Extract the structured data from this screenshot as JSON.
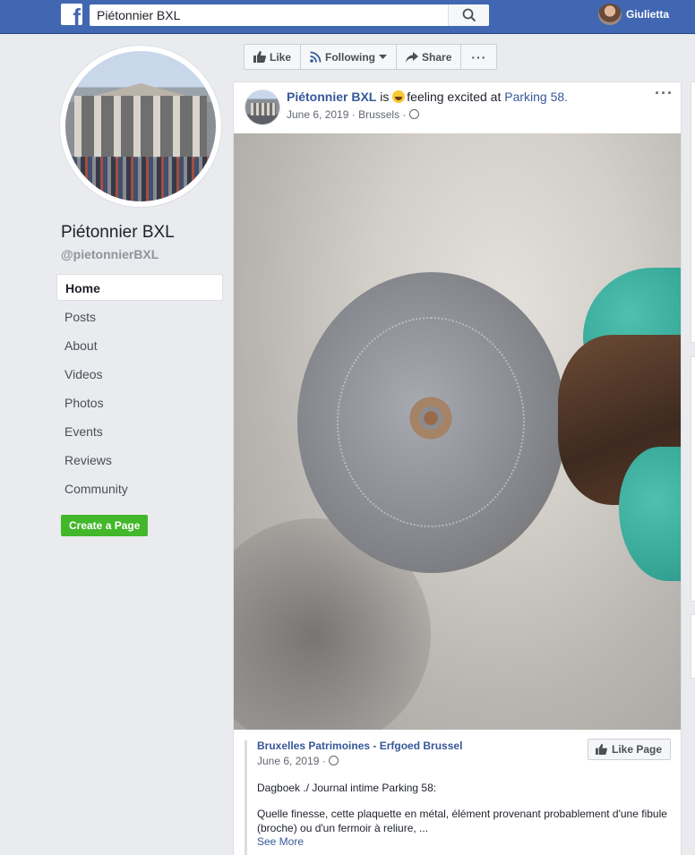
{
  "topbar": {
    "search_value": "Piétonnier BXL",
    "profile_name": "Giulietta"
  },
  "page": {
    "name": "Piétonnier BXL",
    "handle": "@pietonnierBXL"
  },
  "nav": {
    "items": [
      "Home",
      "Posts",
      "About",
      "Videos",
      "Photos",
      "Events",
      "Reviews",
      "Community"
    ],
    "active": "Home"
  },
  "create_page_label": "Create a Page",
  "actions": {
    "like": "Like",
    "following": "Following",
    "share": "Share",
    "more": "···"
  },
  "post": {
    "author": "Piétonnier BXL",
    "verb": "is",
    "feeling": "feeling excited at",
    "place": "Parking 58.",
    "date": "June 6, 2019",
    "location": "Brussels",
    "more": "···"
  },
  "shared": {
    "source": "Bruxelles Patrimoines - Erfgoed Brussel",
    "date": "June 6, 2019",
    "line1": "Dagboek ./ Journal intime Parking 58:",
    "line2": "Quelle finesse, cette plaquette en métal, élément provenant probablement d'une fibule (broche) ou d'un fermoir à reliure, ...",
    "see_more": "See More",
    "like_page": "Like Page"
  },
  "colors": {
    "brand": "#4267b2",
    "link": "#365899",
    "create_button": "#42b72a"
  }
}
